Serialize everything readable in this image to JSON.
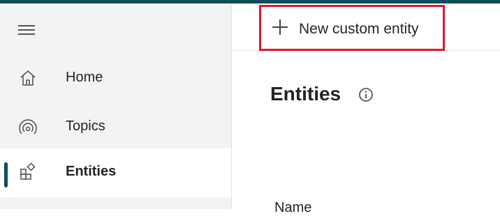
{
  "sidebar": {
    "menu_icon": "hamburger-menu-icon",
    "items": [
      {
        "label": "Home",
        "icon": "home-icon"
      },
      {
        "label": "Topics",
        "icon": "topics-icon"
      },
      {
        "label": "Entities",
        "icon": "entities-icon",
        "active": true
      }
    ]
  },
  "toolbar": {
    "new_label": "New custom entity",
    "new_icon": "plus-icon"
  },
  "main": {
    "title": "Entities",
    "info_icon": "info-icon",
    "column_header": "Name"
  },
  "colors": {
    "accent": "#0f4d5c",
    "highlight_border": "#e3162a",
    "sidebar_bg": "#f3f3f3"
  }
}
